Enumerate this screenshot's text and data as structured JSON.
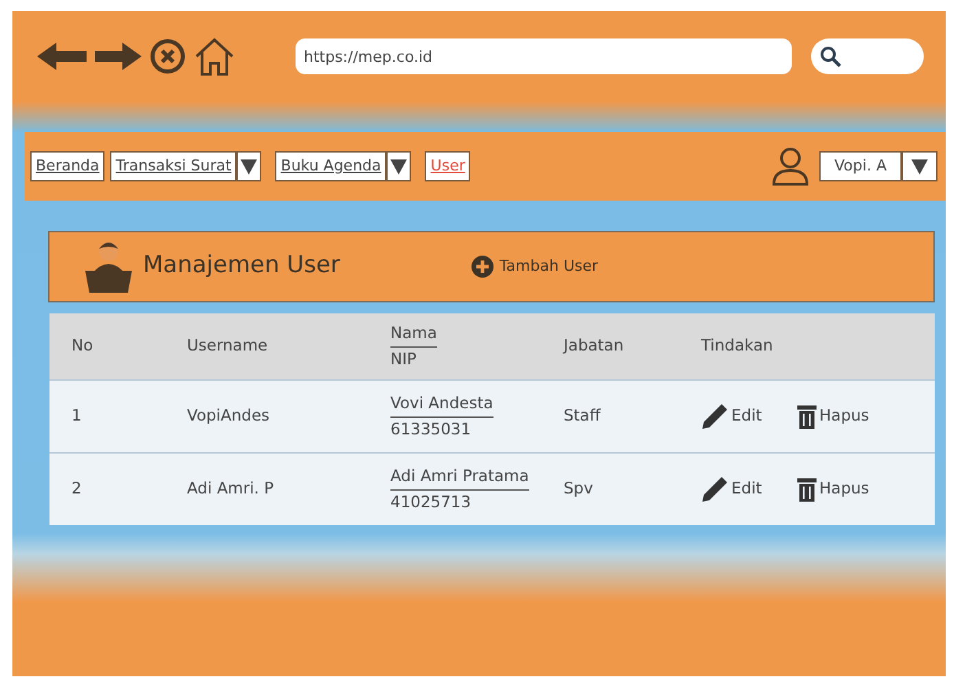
{
  "browser": {
    "url": "https://mep.co.id"
  },
  "nav": {
    "items": [
      {
        "label": "Beranda",
        "kind": "link",
        "selected": false
      },
      {
        "label": "Transaksi Surat",
        "kind": "dropdown",
        "selected": false
      },
      {
        "label": "Buku Agenda",
        "kind": "dropdown",
        "selected": false
      },
      {
        "label": "User",
        "kind": "link",
        "selected": true
      }
    ],
    "user": "Vopi. A"
  },
  "panel": {
    "title": "Manajemen User",
    "add_button": "Tambah User"
  },
  "table": {
    "columns": [
      "No",
      "Username",
      "Nama",
      "NIP",
      "Jabatan",
      "Tindakan"
    ],
    "rows": [
      {
        "no": "1",
        "username": "VopiAndes",
        "nama": "Vovi  Andesta",
        "nip": "61335031",
        "jabatan": "Staff",
        "edit": "Edit",
        "hapus": "Hapus"
      },
      {
        "no": "2",
        "username": "Adi Amri. P",
        "nama": "Adi Amri Pratama",
        "nip": "41025713",
        "jabatan": "Spv",
        "edit": "Edit",
        "hapus": "Hapus"
      }
    ]
  }
}
